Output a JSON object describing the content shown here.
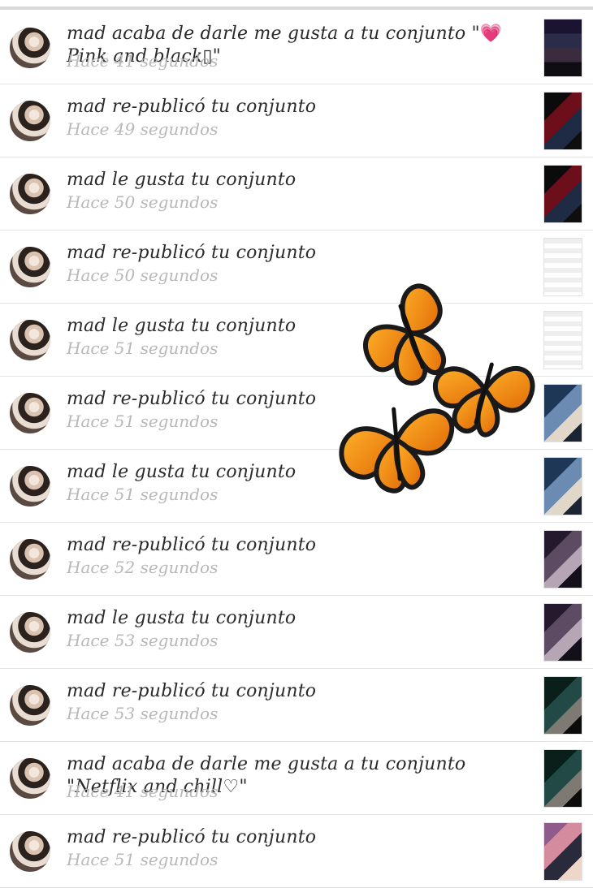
{
  "notifications": [
    {
      "text_parts": [
        "mad acaba de darle me gusta a tu conjunto \"",
        "💗",
        "Pink and black▯\""
      ],
      "time": "Hace 41 segundos",
      "two_line": true,
      "thumb": "t1"
    },
    {
      "text": "mad re-publicó tu conjunto",
      "time": "Hace 49 segundos",
      "thumb": "t2"
    },
    {
      "text": "mad le gusta tu conjunto",
      "time": "Hace 50 segundos",
      "thumb": "t2"
    },
    {
      "text": "mad re-publicó tu conjunto",
      "time": "Hace 50 segundos",
      "thumb": "t3"
    },
    {
      "text": "mad le gusta tu conjunto",
      "time": "Hace 51 segundos",
      "thumb": "t3"
    },
    {
      "text": "mad re-publicó tu conjunto",
      "time": "Hace 51 segundos",
      "thumb": "t4"
    },
    {
      "text": "mad le gusta tu conjunto",
      "time": "Hace 51 segundos",
      "thumb": "t4"
    },
    {
      "text": "mad re-publicó tu conjunto",
      "time": "Hace 52 segundos",
      "thumb": "t5"
    },
    {
      "text": "mad le gusta tu conjunto",
      "time": "Hace 53 segundos",
      "thumb": "t5"
    },
    {
      "text": "mad re-publicó tu conjunto",
      "time": "Hace 53 segundos",
      "thumb": "t6"
    },
    {
      "text": "mad acaba de darle me gusta a tu conjunto \"Netflix and chill♡\"",
      "time": "Hace 41 segundos",
      "two_line": true,
      "thumb": "t6"
    },
    {
      "text": "mad re-publicó tu conjunto",
      "time": "Hace 51 segundos",
      "thumb": "t7"
    }
  ]
}
